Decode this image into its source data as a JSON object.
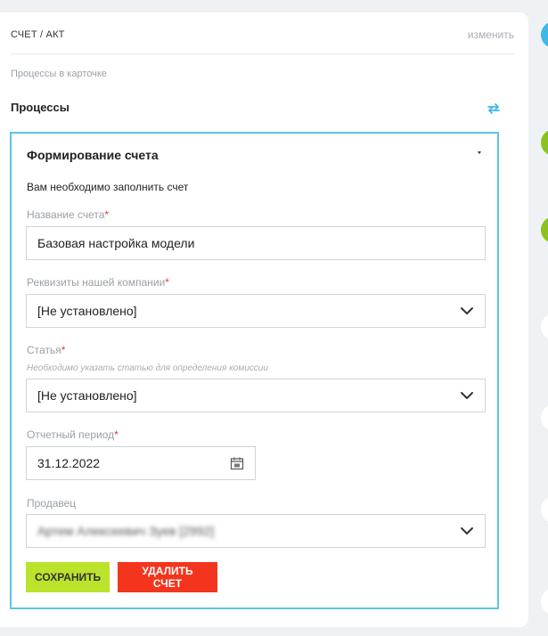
{
  "card": {
    "title": "СЧЕТ / АКТ",
    "edit_label": "изменить",
    "subtitle": "Процессы в карточке",
    "section_title": "Процессы"
  },
  "process": {
    "title": "Формирование счета",
    "instruction": "Вам необходимо заполнить счет",
    "fields": {
      "invoice_name": {
        "label": "Название счета",
        "required": "*",
        "value": "Базовая настройка модели"
      },
      "company_details": {
        "label": "Реквизиты нашей компании",
        "required": "*",
        "value": "[Не установлено]"
      },
      "article": {
        "label": "Статья",
        "required": "*",
        "hint": "Необходимо указать статью для определения комиссии",
        "value": "[Не установлено]"
      },
      "period": {
        "label": "Отчетный период",
        "required": "*",
        "value": "31.12.2022"
      },
      "seller": {
        "label": "Продавец",
        "value": "Артем Алексеевич Зуев [2992]"
      }
    },
    "buttons": {
      "save": "СОХРАНИТЬ",
      "delete": "УДАЛИТЬ СЧЕТ"
    }
  },
  "icons": {
    "refresh": "refresh-icon",
    "caret": "caret-down-icon",
    "chevron": "chevron-down-icon",
    "calendar": "calendar-icon"
  },
  "colors": {
    "accent_border": "#5bc6e4",
    "save_button": "#bbe32c",
    "delete_button": "#f4351e",
    "required": "#e53935",
    "side_blue": "#3fb8e8",
    "side_green": "#8cc21f"
  }
}
